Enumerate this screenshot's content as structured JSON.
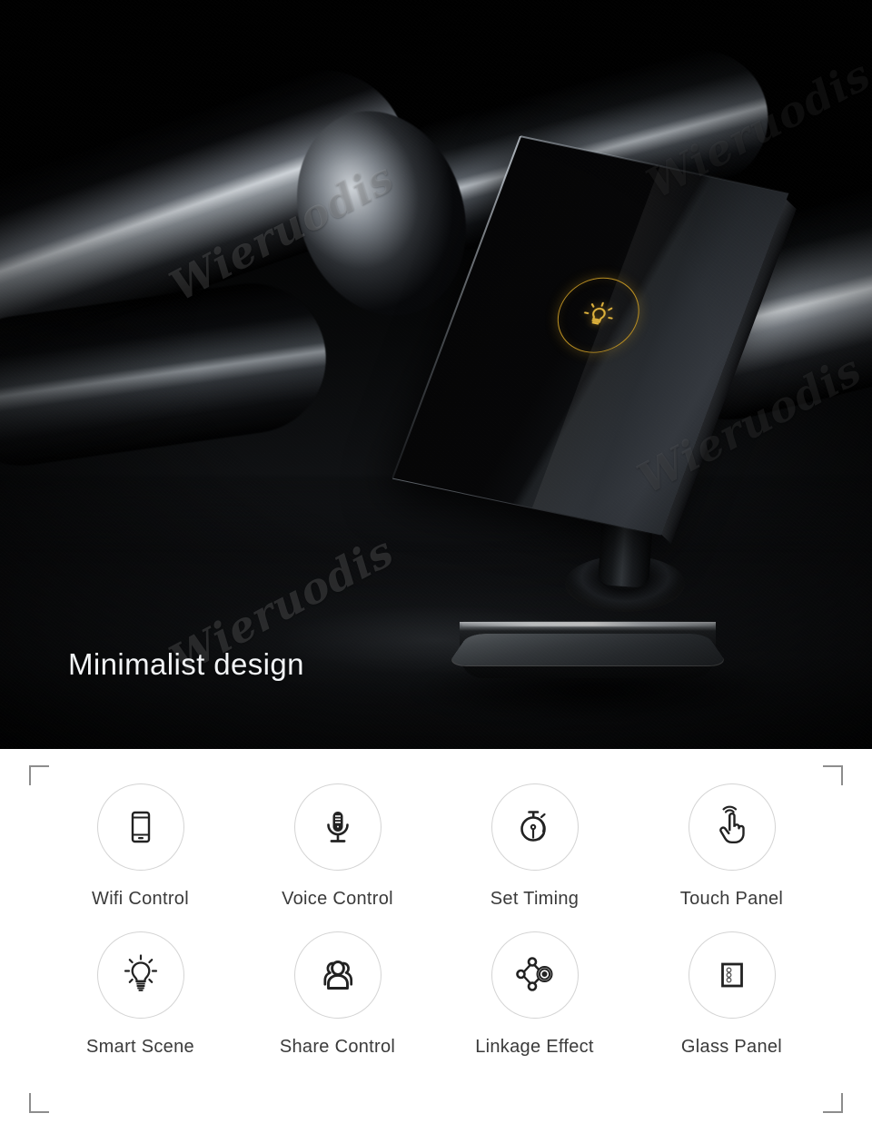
{
  "hero": {
    "caption": "Minimalist design",
    "watermark": "Wieruodis",
    "product": {
      "name": "smart-touch-wall-switch",
      "panel_color": "#060607",
      "indicator_icon": "light-bulb-icon",
      "indicator_color": "#d6a72e",
      "base_material": "brushed-metal"
    },
    "background": "dark-rubber-cylinders"
  },
  "features": {
    "accent_color": "#8d8d8d",
    "label_color": "#3a3a3a",
    "items": [
      {
        "icon": "smartphone-icon",
        "label": "Wifi Control"
      },
      {
        "icon": "microphone-icon",
        "label": "Voice Control"
      },
      {
        "icon": "stopwatch-icon",
        "label": "Set Timing"
      },
      {
        "icon": "tap-hand-icon",
        "label": "Touch Panel"
      },
      {
        "icon": "light-bulb-icon",
        "label": "Smart Scene"
      },
      {
        "icon": "people-group-icon",
        "label": "Share Control"
      },
      {
        "icon": "network-nodes-icon",
        "label": "Linkage Effect"
      },
      {
        "icon": "switch-plate-icon",
        "label": "Glass Panel"
      }
    ]
  }
}
